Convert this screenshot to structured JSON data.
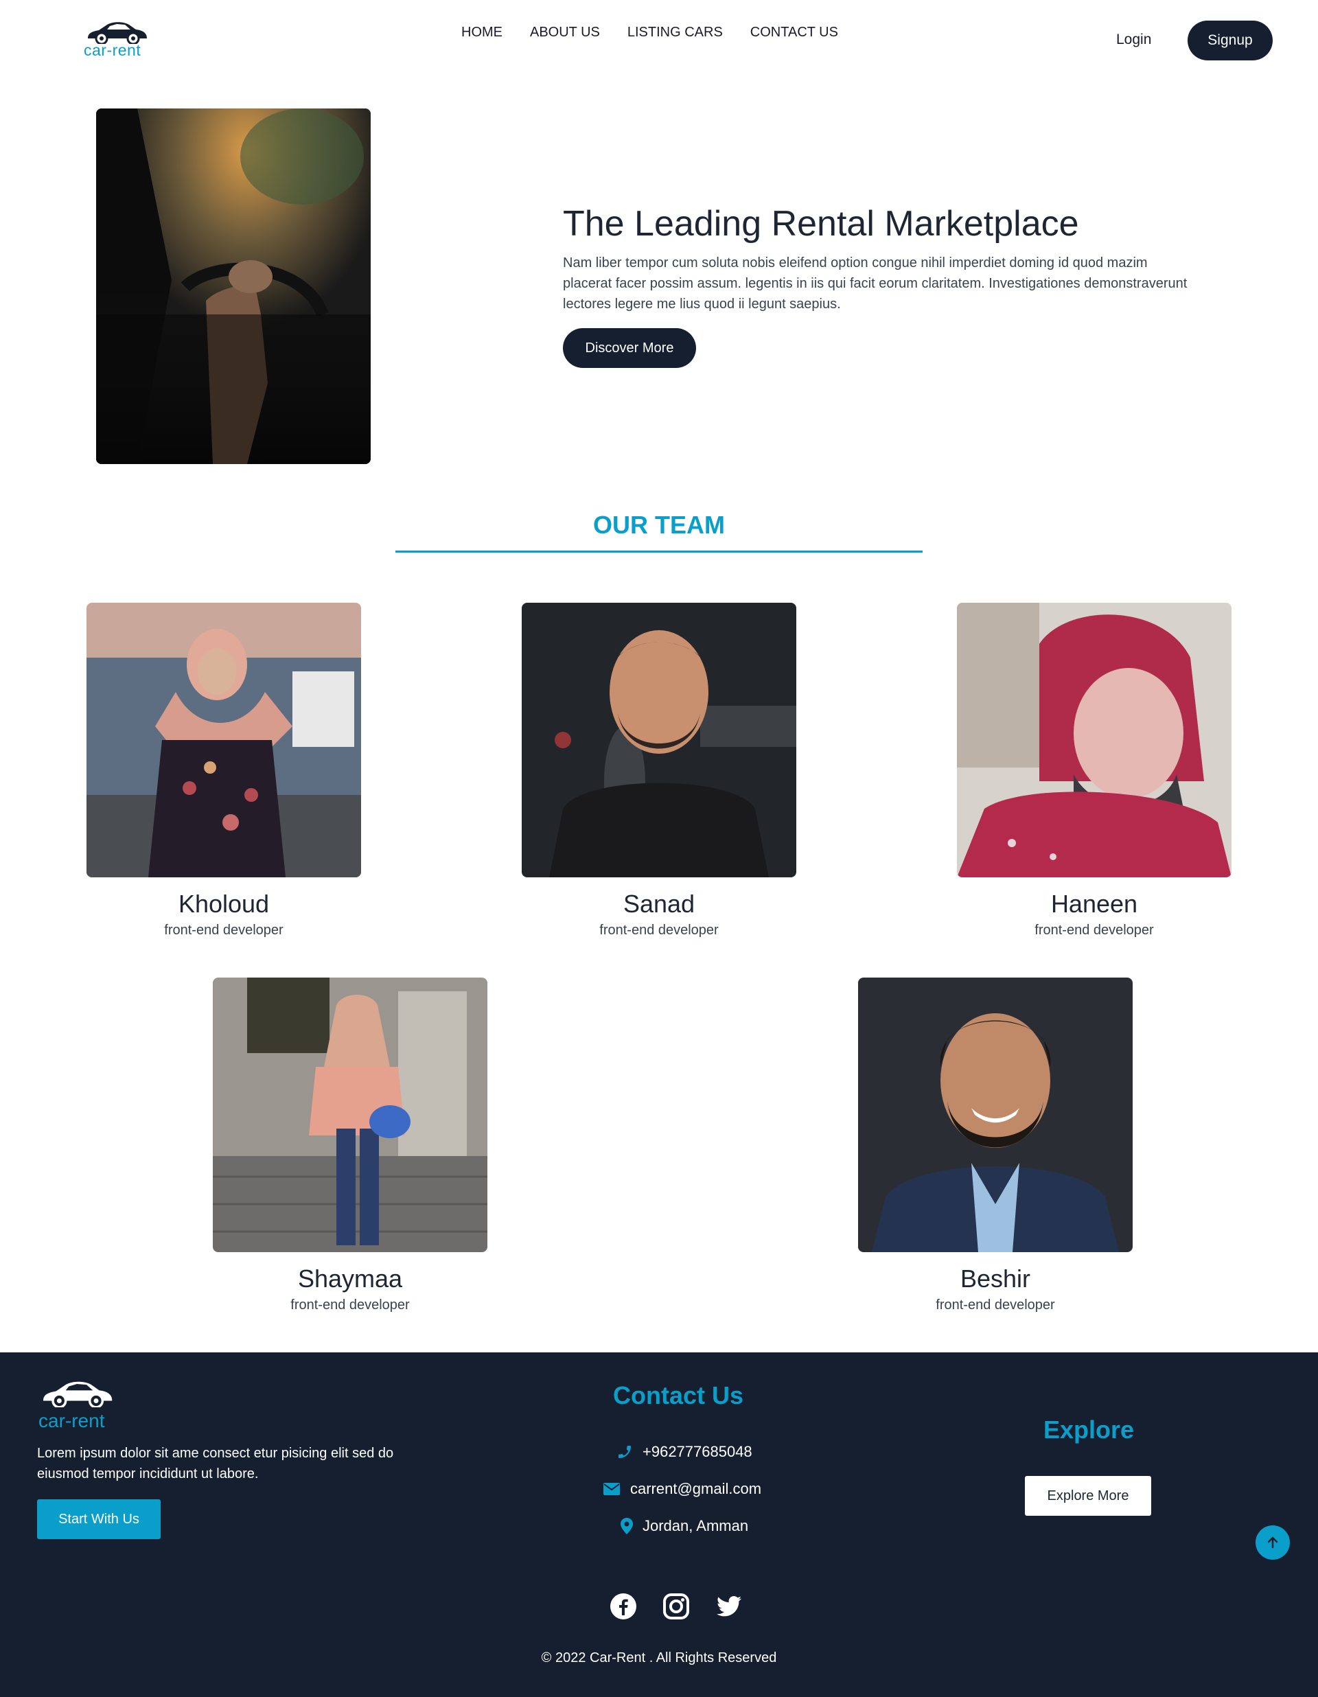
{
  "colors": {
    "accent": "#0a9fca",
    "dark": "#161f30",
    "text": "#1e2633"
  },
  "brand": {
    "logo_text": "car-rent",
    "logo_icon": "car-icon"
  },
  "nav": {
    "items": [
      {
        "label": "HOME"
      },
      {
        "label": "ABOUT US"
      },
      {
        "label": "LISTING CARS"
      },
      {
        "label": "CONTACT US"
      }
    ],
    "login_label": "Login",
    "signup_label": "Signup"
  },
  "hero": {
    "title": "The Leading Rental Marketplace",
    "text": "Nam liber tempor cum soluta nobis eleifend option congue nihil imperdiet doming id quod mazim placerat facer possim assum. legentis in iis qui facit eorum claritatem. Investigationes demonstraverunt lectores legere me lius quod ii legunt saepius.",
    "button_label": "Discover More"
  },
  "team": {
    "title": "OUR TEAM",
    "members": [
      {
        "name": "Kholoud",
        "role": "front-end developer"
      },
      {
        "name": "Sanad",
        "role": "front-end developer"
      },
      {
        "name": "Haneen",
        "role": "front-end developer"
      },
      {
        "name": "Shaymaa",
        "role": "front-end developer"
      },
      {
        "name": "Beshir",
        "role": "front-end developer"
      }
    ]
  },
  "footer": {
    "logo_text": "car-rent",
    "about": "Lorem ipsum dolor sit ame consect etur pisicing elit sed do eiusmod tempor incididunt ut labore.",
    "start_label": "Start With Us",
    "contact_title": "Contact Us",
    "phone": "+962777685048",
    "email": "carrent@gmail.com",
    "location": "Jordan, Amman",
    "explore_title": "Explore",
    "explore_label": "Explore More",
    "socials": [
      "facebook-icon",
      "instagram-icon",
      "twitter-icon"
    ],
    "copyright": "© 2022 Car-Rent . All Rights Reserved"
  }
}
